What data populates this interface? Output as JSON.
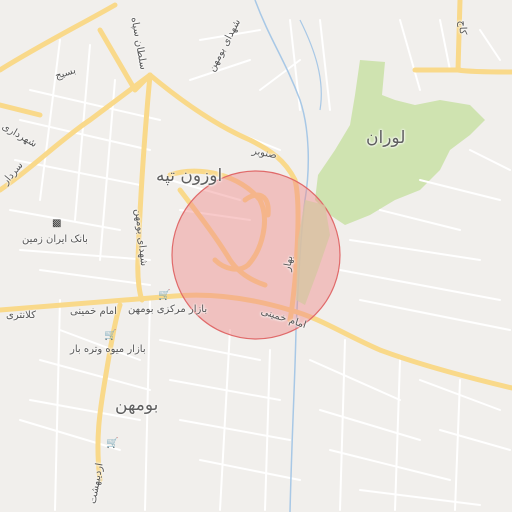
{
  "map": {
    "colors": {
      "background": "#f1efec",
      "park": "#cfe3b0",
      "major_road": "#f9d98a",
      "minor_road": "#ffffff",
      "water": "#a8c8e6",
      "highlight_fill": "#f08a8a",
      "highlight_stroke": "#e06a6a"
    },
    "districts": {
      "uzun_tappeh": "اوزون تپه",
      "luran": "لوران",
      "boomehen": "بومهن"
    },
    "streets": {
      "imam_khomeini_1": "امام خمینی",
      "imam_khomeini_2": "امام خمینی",
      "imam_khomeini_3": "امام خمینی",
      "basij": "بسیج",
      "shohada_boomehen": "شهدای بومهن",
      "shohada_boomehen_2": "شهدای بومهن",
      "soltan_sepah": "سلطان سپاه",
      "senobar": "صنوبر",
      "bahar": "بهار",
      "kalantari": "کلانتری",
      "shahrdari": "شهرداری",
      "sardar": "سردار",
      "ordibehesht": "اردیبهشت",
      "kaj": "کاج"
    },
    "pois": {
      "bank": "بانک ایران زمین",
      "central_market": "بازار مرکزی بومهن",
      "fruit_market": "بازار میوه وتره بار"
    },
    "icons": {
      "bank": "bank-icon",
      "shopping": "shopping-cart-icon"
    }
  }
}
